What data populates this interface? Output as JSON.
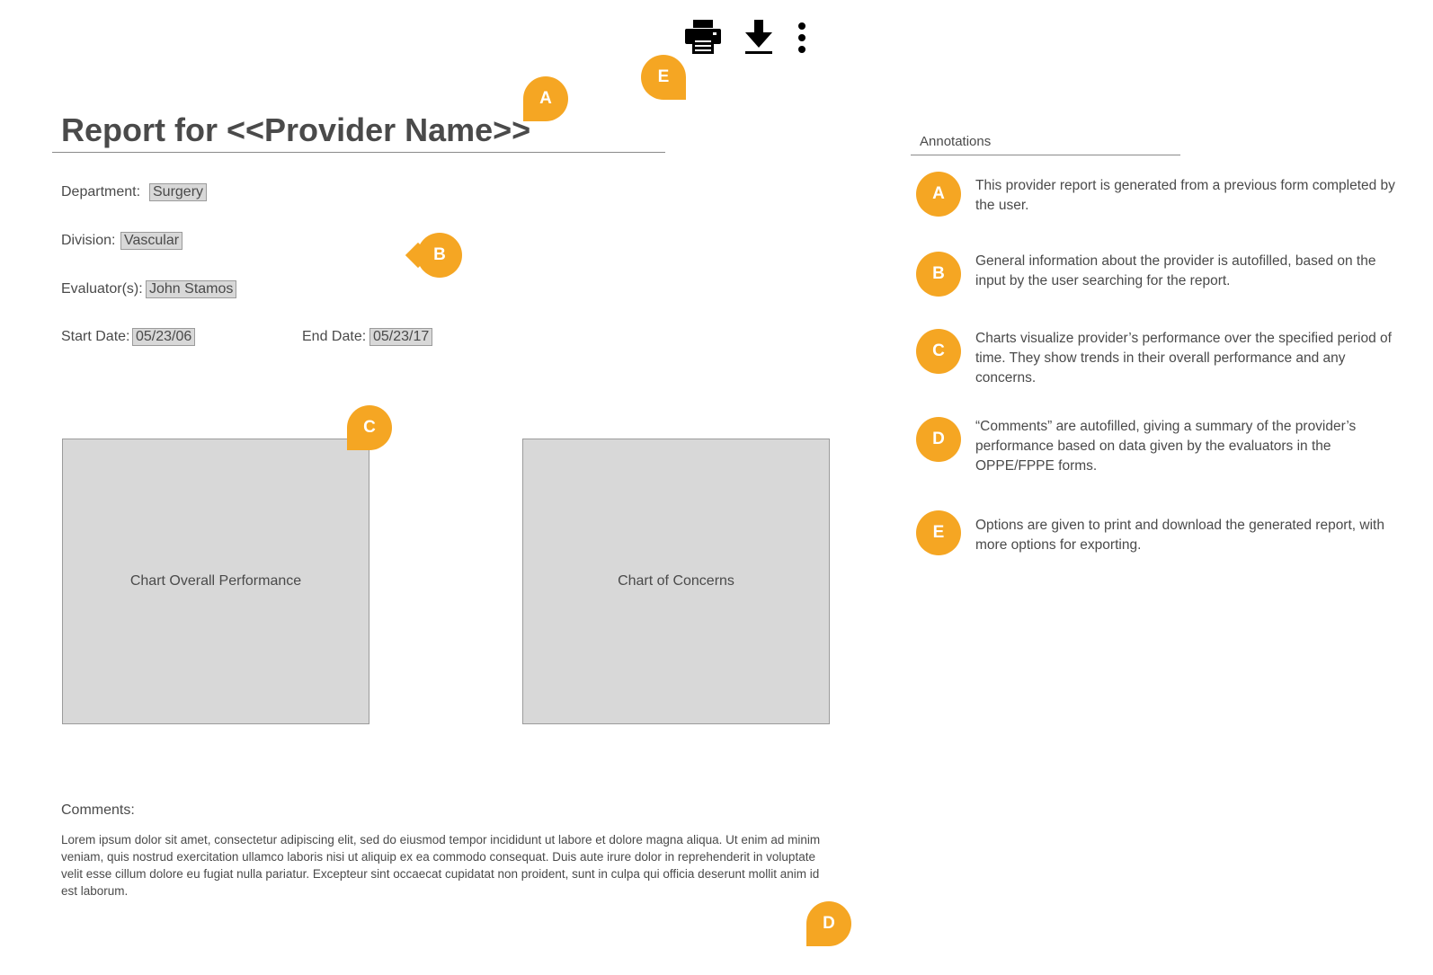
{
  "toolbar": {
    "print_icon": "printer-icon",
    "download_icon": "download-icon",
    "more_icon": "more-vertical-icon"
  },
  "report": {
    "title": "Report for <<Provider Name>>",
    "department_label": "Department:",
    "department_value": "Surgery",
    "division_label": "Division:",
    "division_value": "Vascular",
    "evaluator_label": "Evaluator(s):",
    "evaluator_value": "John Stamos",
    "start_date_label": "Start Date:",
    "start_date_value": "05/23/06",
    "end_date_label": "End Date:",
    "end_date_value": "05/23/17"
  },
  "charts": {
    "overall_label": "Chart Overall Performance",
    "concerns_label": "Chart of Concerns"
  },
  "comments": {
    "label": "Comments:",
    "text": "Lorem ipsum dolor sit amet, consectetur adipiscing elit, sed do eiusmod tempor incididunt ut labore et dolore magna aliqua. Ut enim ad minim veniam, quis nostrud exercitation ullamco laboris nisi ut aliquip ex ea commodo consequat. Duis aute irure dolor in reprehenderit in voluptate velit esse cillum dolore eu fugiat nulla pariatur. Excepteur sint occaecat cupidatat non proident, sunt in culpa qui officia deserunt mollit anim id est laborum."
  },
  "markers": {
    "a": "A",
    "b": "B",
    "c": "C",
    "d": "D",
    "e": "E"
  },
  "annotations": {
    "title": "Annotations",
    "items": [
      {
        "letter": "A",
        "text": "This provider report is generated from a previous form completed by the user."
      },
      {
        "letter": "B",
        "text": "General information about the provider is autofilled, based on the input by the user searching for the report."
      },
      {
        "letter": "C",
        "text": "Charts visualize provider’s performance over the specified period of time. They show trends in their overall performance and any concerns."
      },
      {
        "letter": "D",
        "text": "“Comments” are autofilled, giving a summary of the provider’s performance based on data given by the evaluators in the OPPE/FPPE forms."
      },
      {
        "letter": "E",
        "text": "Options are given to print and download the generated report, with more options for exporting."
      }
    ]
  },
  "colors": {
    "accent": "#f5a623",
    "placeholder": "#d8d8d8",
    "text": "#4a4a4a"
  }
}
